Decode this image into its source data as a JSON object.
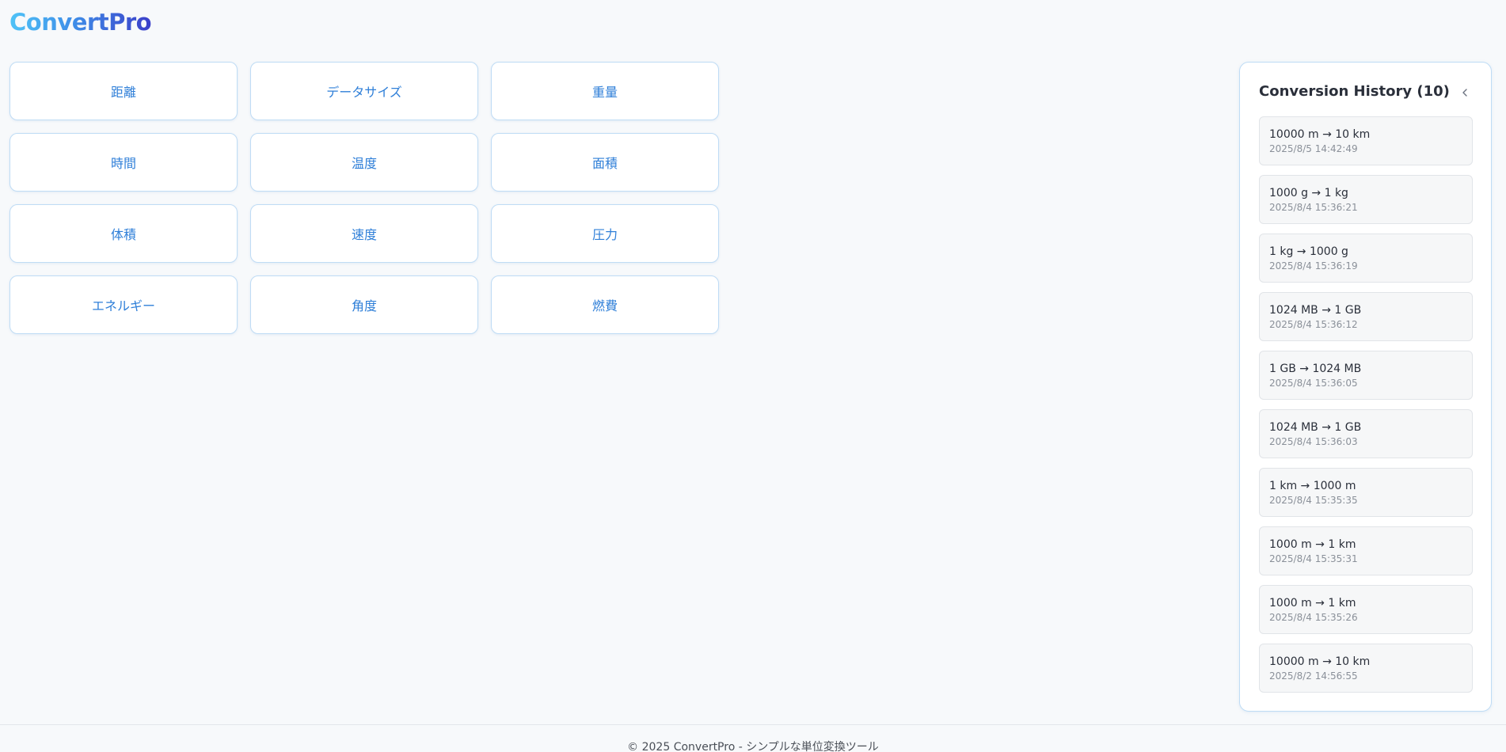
{
  "app": {
    "logo": "ConvertPro"
  },
  "categories": [
    "距離",
    "データサイズ",
    "重量",
    "時間",
    "温度",
    "面積",
    "体積",
    "速度",
    "圧力",
    "エネルギー",
    "角度",
    "燃費"
  ],
  "history": {
    "title": "Conversion History (10)",
    "collapse_icon": "chevron-left-icon",
    "items": [
      {
        "conversion": "10000 m → 10 km",
        "time": "2025/8/5 14:42:49"
      },
      {
        "conversion": "1000 g → 1 kg",
        "time": "2025/8/4 15:36:21"
      },
      {
        "conversion": "1 kg → 1000 g",
        "time": "2025/8/4 15:36:19"
      },
      {
        "conversion": "1024 MB → 1 GB",
        "time": "2025/8/4 15:36:12"
      },
      {
        "conversion": "1 GB → 1024 MB",
        "time": "2025/8/4 15:36:05"
      },
      {
        "conversion": "1024 MB → 1 GB",
        "time": "2025/8/4 15:36:03"
      },
      {
        "conversion": "1 km → 1000 m",
        "time": "2025/8/4 15:35:35"
      },
      {
        "conversion": "1000 m → 1 km",
        "time": "2025/8/4 15:35:31"
      },
      {
        "conversion": "1000 m → 1 km",
        "time": "2025/8/4 15:35:26"
      },
      {
        "conversion": "10000 m → 10 km",
        "time": "2025/8/2 14:56:55"
      }
    ]
  },
  "footer": {
    "text": "© 2025 ConvertPro - シンプルな単位変換ツール"
  },
  "colors": {
    "accent": "#2f7fd8",
    "border": "#bfdcf5",
    "background": "#f7f9fb"
  }
}
